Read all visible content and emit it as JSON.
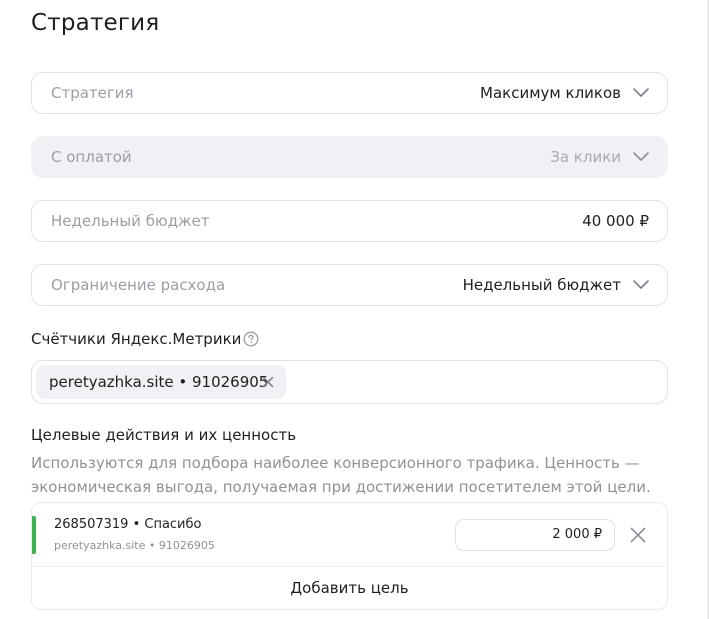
{
  "title": "Стратегия",
  "fields": {
    "strategy": {
      "label": "Стратегия",
      "value": "Максимум кликов"
    },
    "payment": {
      "label": "С оплатой",
      "value": "За клики"
    },
    "budget": {
      "label": "Недельный бюджет",
      "value": "40 000  ₽"
    },
    "limit": {
      "label": "Ограничение расхода",
      "value": "Недельный бюджет"
    }
  },
  "counters": {
    "label": "Счётчики Яндекс.Метрики",
    "chip": "peretyazhka.site • 91026905"
  },
  "goals": {
    "label": "Целевые действия и их ценность",
    "description": "Используются для подбора наиболее конверсионного трафика. Ценность — экономическая выгода, получаемая при достижении посетителем этой цели.",
    "items": [
      {
        "title": "268507319 • Спасибо",
        "subtitle": "peretyazhka.site • 91026905",
        "value": "2 000  ₽",
        "accent_color": "#3eb34f"
      }
    ],
    "add_label": "Добавить цель"
  },
  "icons": {
    "chevron": "chevron-down-icon",
    "help": "question-circle-icon",
    "close": "close-icon"
  }
}
